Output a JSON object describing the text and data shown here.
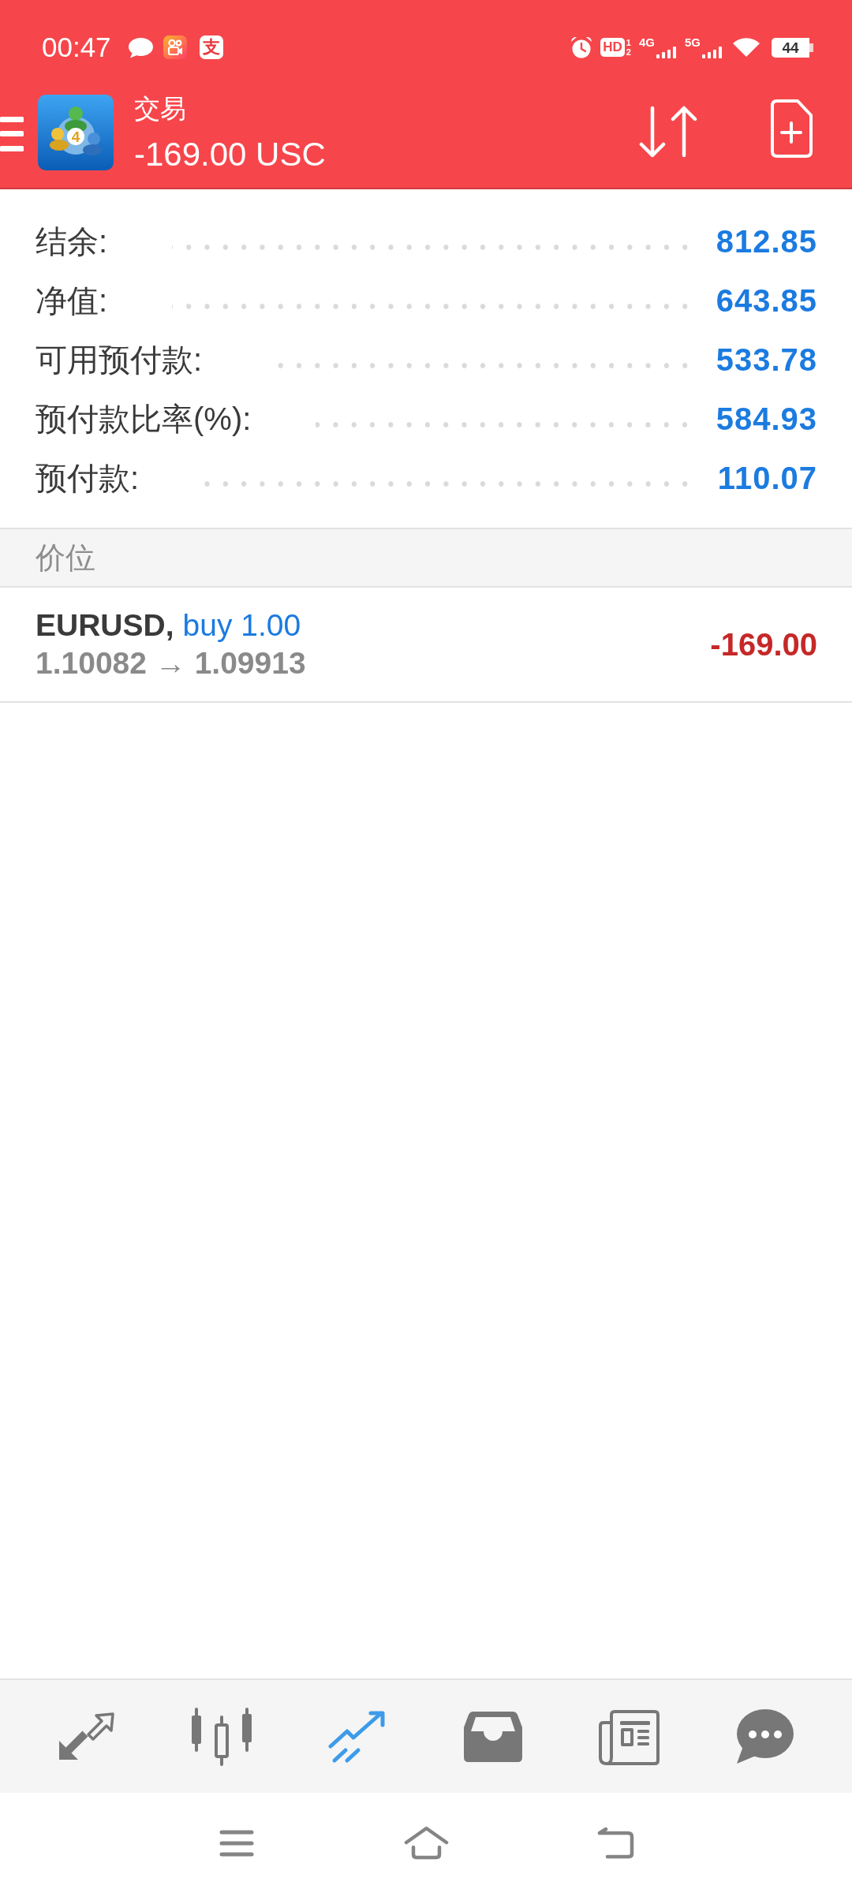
{
  "status_bar": {
    "time": "00:47",
    "app_logo_text": "支",
    "hd_label": "HD",
    "sim_slots": [
      "1",
      "2"
    ],
    "networks": [
      {
        "label": "4G"
      },
      {
        "label": "5G"
      }
    ],
    "battery": "44"
  },
  "toolbar": {
    "logo_text": "4",
    "title": "交易",
    "balance": "-169.00 USC"
  },
  "account": [
    {
      "label": "结余:",
      "value": "812.85"
    },
    {
      "label": "净值:",
      "value": "643.85"
    },
    {
      "label": "可用预付款:",
      "value": "533.78"
    },
    {
      "label": "预付款比率(%):",
      "value": "584.93"
    },
    {
      "label": "预付款:",
      "value": "110.07"
    }
  ],
  "positions_section": {
    "title": "价位",
    "positions": [
      {
        "symbol": "EURUSD,",
        "order": "buy 1.00",
        "prices": "1.10082 → 1.09913",
        "profit": "-169.00"
      }
    ]
  },
  "bottom_nav": [
    {
      "selected": false
    },
    {
      "selected": false
    },
    {
      "selected": true
    },
    {
      "selected": false
    },
    {
      "selected": false
    },
    {
      "selected": false
    }
  ]
}
